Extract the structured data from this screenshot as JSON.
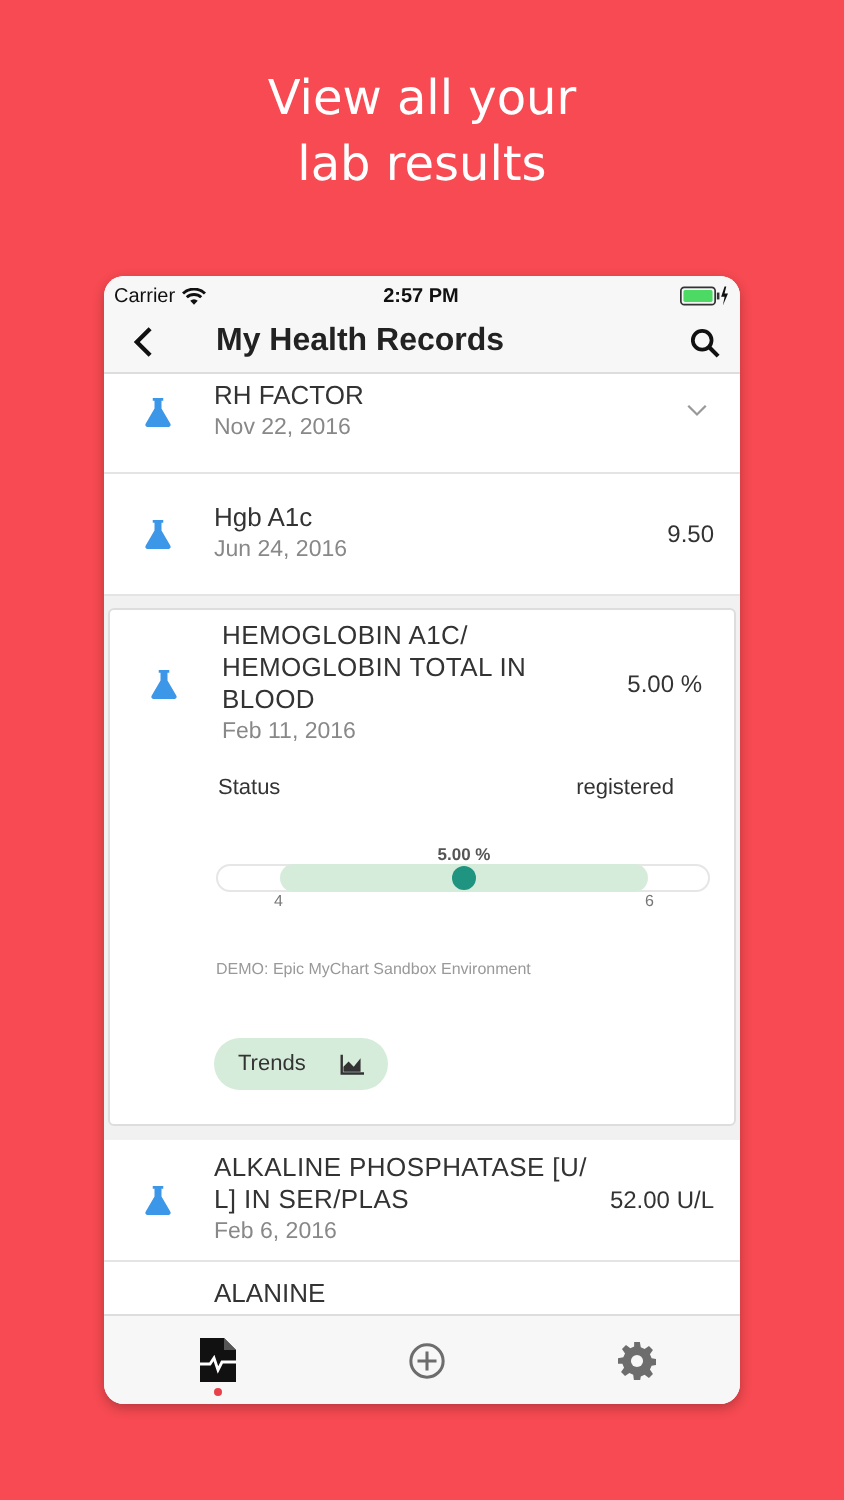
{
  "headline": [
    "View all your",
    "lab results"
  ],
  "status_bar": {
    "carrier": "Carrier",
    "time": "2:57 PM"
  },
  "nav": {
    "title": "My Health Records"
  },
  "results": [
    {
      "kind": "collapsed",
      "title": "RH FACTOR",
      "date": "Nov 22, 2016",
      "expanded": false
    },
    {
      "kind": "row",
      "title": "Hgb A1c",
      "date": "Jun 24, 2016",
      "value": "9.50"
    },
    {
      "kind": "detail",
      "title": "HEMOGLOBIN A1C/ HEMOGLOBIN TOTAL IN BLOOD",
      "date": "Feb 11, 2016",
      "value": "5.00 %",
      "status_label": "Status",
      "status": "registered",
      "range": {
        "reading": "5.00 %",
        "level": 0.5,
        "low": "4",
        "high": "6"
      },
      "source": "DEMO: Epic MyChart Sandbox Environment",
      "button": "Trends"
    },
    {
      "kind": "row",
      "title": "ALKALINE PHOSPHATASE [U/ L] IN SER/PLAS",
      "date": "Feb 6, 2016",
      "value": "52.00 U/L"
    },
    {
      "kind": "cut",
      "title": "ALANINE"
    }
  ],
  "tabs": [
    {
      "kind": "records",
      "selected": true
    },
    {
      "kind": "add",
      "selected": false
    },
    {
      "kind": "settings",
      "selected": false
    }
  ]
}
